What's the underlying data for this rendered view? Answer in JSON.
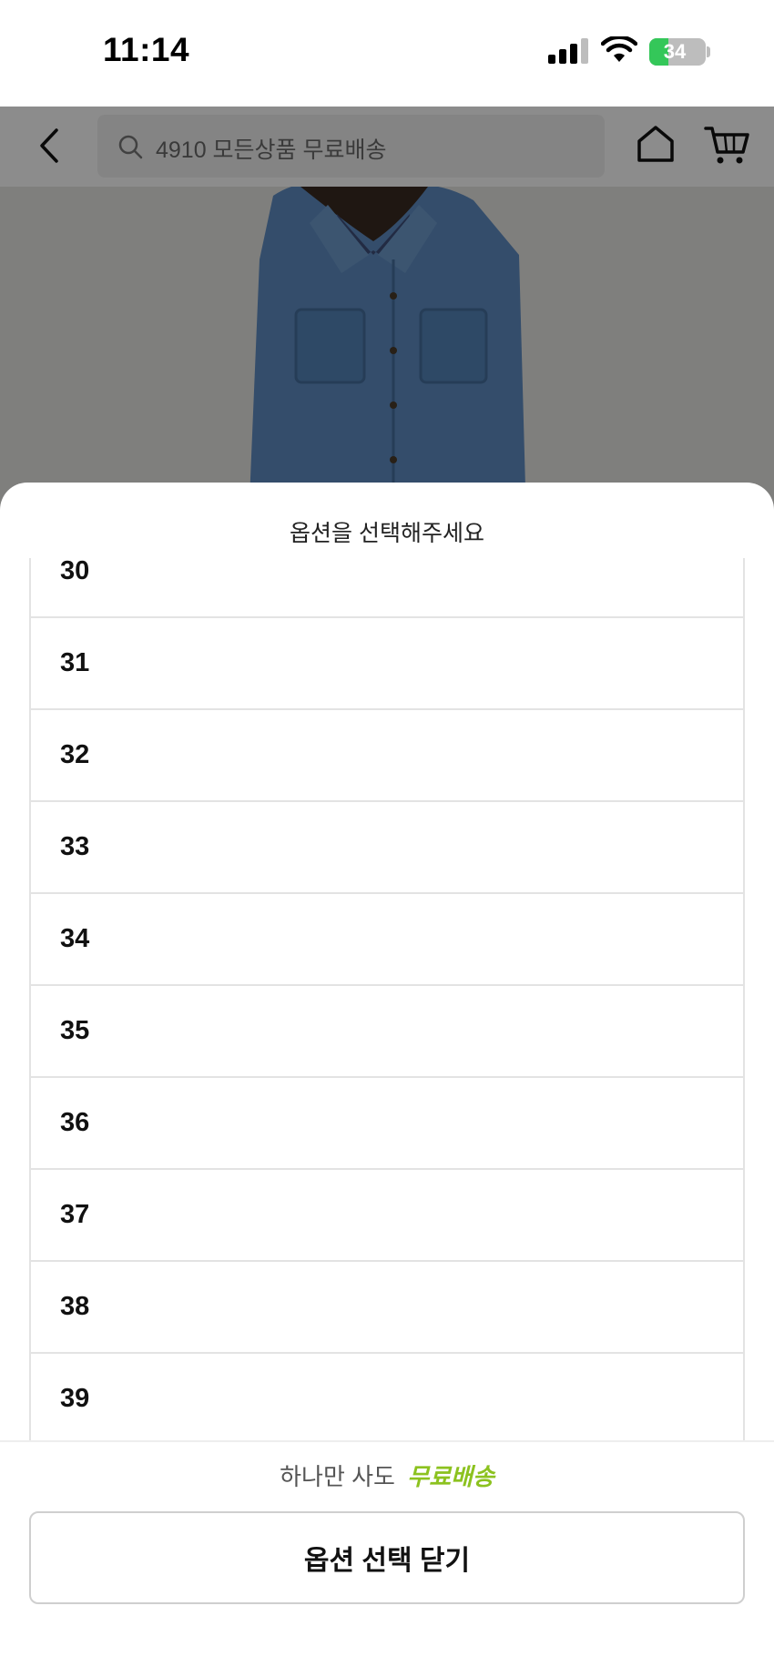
{
  "status_bar": {
    "time": "11:14",
    "battery_percent": "34",
    "battery_level": 0.34,
    "icons": [
      "cellular-signal-icon",
      "wifi-icon",
      "battery-charging-icon"
    ]
  },
  "header": {
    "search_placeholder": "4910 모든상품 무료배송",
    "icons": [
      "back-arrow-icon",
      "search-icon",
      "home-icon",
      "cart-icon"
    ]
  },
  "sheet": {
    "title": "옵션을 선택해주세요",
    "options": [
      "30",
      "31",
      "32",
      "33",
      "34",
      "35",
      "36",
      "37",
      "38",
      "39"
    ],
    "promo_prefix": "하나만 사도",
    "promo_highlight": "무료배송",
    "close_label": "옵션 선택 닫기",
    "accent_color": "#8cc21f"
  }
}
